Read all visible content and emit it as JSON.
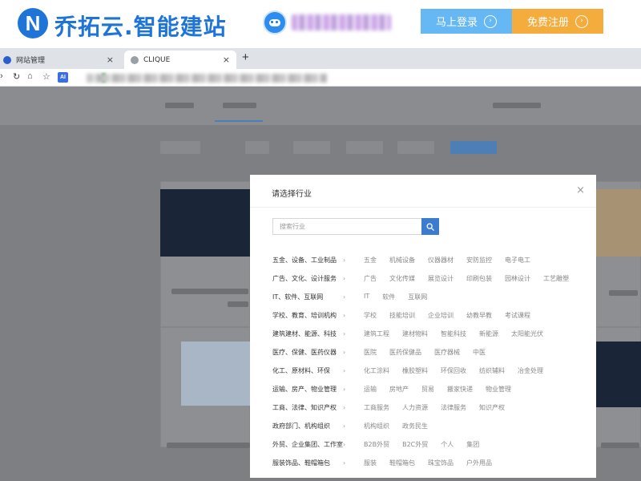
{
  "site": {
    "brand_logo_letter": "N",
    "brand_name": "乔拓云.智能建站",
    "login_label": "马上登录",
    "register_label": "免费注册",
    "arrow_glyph": "›"
  },
  "browser": {
    "tabs": [
      {
        "title": "网站管理",
        "favicon_color": "#2a5fc9"
      },
      {
        "title": "CLIQUE",
        "favicon_color": "#9aa0a6"
      }
    ],
    "close_glyph": "×",
    "new_tab_glyph": "+",
    "ai_badge": "AI"
  },
  "modal": {
    "title": "请选择行业",
    "close_glyph": "×",
    "search_placeholder": "搜索行业",
    "categories": [
      {
        "name": "五金、设备、工业制品",
        "subs": [
          "五金",
          "机械设备",
          "仪器器材",
          "安防监控",
          "电子电工"
        ]
      },
      {
        "name": "广告、文化、设计服务",
        "subs": [
          "广告",
          "文化传媒",
          "展览设计",
          "印刷包装",
          "园林设计",
          "工艺雕塑"
        ]
      },
      {
        "name": "IT、软件、互联网",
        "subs": [
          "IT",
          "软件",
          "互联网"
        ]
      },
      {
        "name": "学校、教育、培训机构",
        "subs": [
          "学校",
          "技能培训",
          "企业培训",
          "幼教早教",
          "考试课程"
        ]
      },
      {
        "name": "建筑建材、能源、科技",
        "subs": [
          "建筑工程",
          "建材物料",
          "智能科技",
          "新能源",
          "太阳能光伏"
        ]
      },
      {
        "name": "医疗、保健、医药仪器",
        "subs": [
          "医院",
          "医药保健品",
          "医疗器械",
          "中医"
        ]
      },
      {
        "name": "化工、原材料、环保",
        "subs": [
          "化工涂料",
          "橡胶塑料",
          "环保回收",
          "纺织辅料",
          "冶金处理"
        ]
      },
      {
        "name": "运输、房产、物业管理",
        "subs": [
          "运输",
          "房地产",
          "贸易",
          "搬家快递",
          "物业管理"
        ]
      },
      {
        "name": "工商、法律、知识产权",
        "subs": [
          "工商服务",
          "人力资源",
          "法律服务",
          "知识产权"
        ]
      },
      {
        "name": "政府部门、机构组织",
        "subs": [
          "机构组织",
          "政务民生"
        ]
      },
      {
        "name": "外贸、企业集团、工作室",
        "subs": [
          "B2B外贸",
          "B2C外贸",
          "个人",
          "集团"
        ]
      },
      {
        "name": "服装饰品、鞋帽箱包",
        "subs": [
          "服装",
          "鞋帽箱包",
          "珠宝饰品",
          "户外用品"
        ]
      }
    ]
  },
  "colors": {
    "brand_blue": "#1f74d8",
    "login_blue": "#65b8f4",
    "register_orange": "#f4ac3d",
    "search_button_blue": "#3c7ccf",
    "overlay_gray": "#7d7f83"
  }
}
